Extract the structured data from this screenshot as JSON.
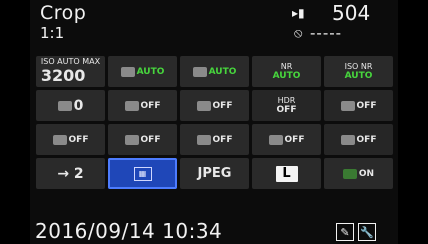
{
  "header": {
    "title": "Crop",
    "subtitle": "1:1",
    "card_icon": "sd-card-icon",
    "shots_remaining": "504",
    "wifi_icon": "wifi-off-icon",
    "status_dashes": "-----"
  },
  "grid": {
    "rows": [
      [
        {
          "top": "ISO AUTO MAX",
          "main": "3200"
        },
        {
          "icon": "auto-exposure-icon",
          "badge": "AUTO"
        },
        {
          "icon": "auto-white-balance-icon",
          "badge": "AUTO"
        },
        {
          "top": "NR",
          "badge": "AUTO"
        },
        {
          "top": "ISO NR",
          "badge": "AUTO"
        }
      ],
      [
        {
          "icon": "exposure-comp-icon",
          "main": "0"
        },
        {
          "icon": "highlight-icon",
          "badge": "OFF"
        },
        {
          "icon": "shadow-icon",
          "badge": "OFF"
        },
        {
          "top": "HDR",
          "badge": "OFF"
        },
        {
          "icon": "grid-icon",
          "badge": "OFF"
        }
      ],
      [
        {
          "icon": "multi-dot-icon",
          "badge": "OFF"
        },
        {
          "icon": "frame-icon",
          "badge": "OFF"
        },
        {
          "icon": "lens-correction-icon",
          "badge": "OFF"
        },
        {
          "icon": "stripes-icon",
          "badge": "OFF"
        },
        {
          "icon": "shake-reduction-icon",
          "badge": "OFF"
        }
      ],
      [
        {
          "icon": "card-slot-arrow-icon",
          "main": "→ 2"
        },
        {
          "icon": "crop-frame-icon",
          "selected": true
        },
        {
          "main": "JPEG"
        },
        {
          "main": "L"
        },
        {
          "icon": "green-plus-icon",
          "badge": "ON"
        }
      ]
    ]
  },
  "footer": {
    "datetime": "2016/09/14 10:34",
    "button1_icon": "pen-icon",
    "button2_icon": "wrench-icon"
  }
}
